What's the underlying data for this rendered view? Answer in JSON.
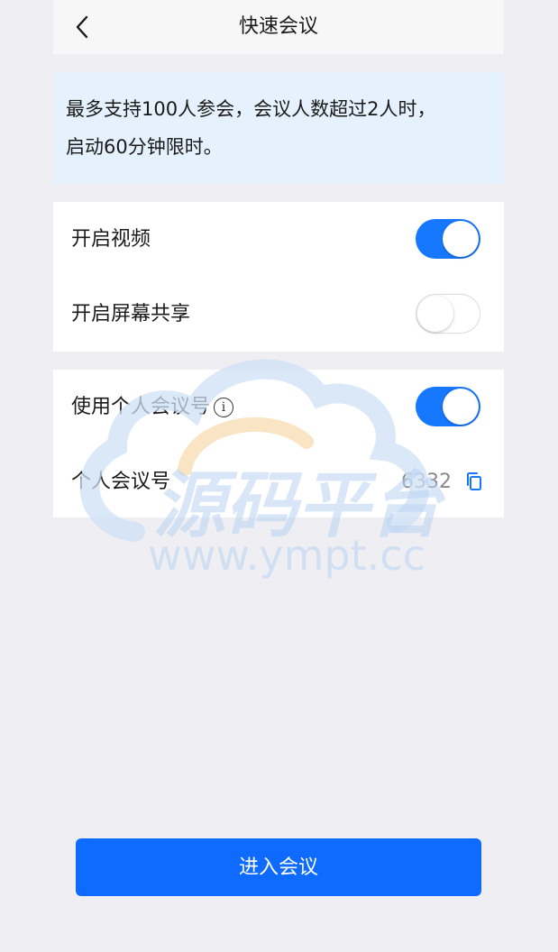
{
  "navbar": {
    "title": "快速会议"
  },
  "notice": {
    "line1": "最多支持100人参会，会议人数超过2人时，",
    "line2": "启动60分钟限时。"
  },
  "settings": {
    "video": {
      "label": "开启视频",
      "enabled": true
    },
    "screen_share": {
      "label": "开启屏幕共享",
      "enabled": false
    },
    "personal_id": {
      "label": "使用个人会议号",
      "enabled": true
    },
    "personal_number": {
      "label": "个人会议号",
      "value": "6332"
    }
  },
  "actions": {
    "enter_label": "进入会议"
  },
  "watermark": {
    "brand": "源码平台",
    "url": "www.ympt.cc"
  },
  "colors": {
    "accent": "#1677ff",
    "notice_bg": "#e5f2fd",
    "page_bg": "#efeff3"
  }
}
